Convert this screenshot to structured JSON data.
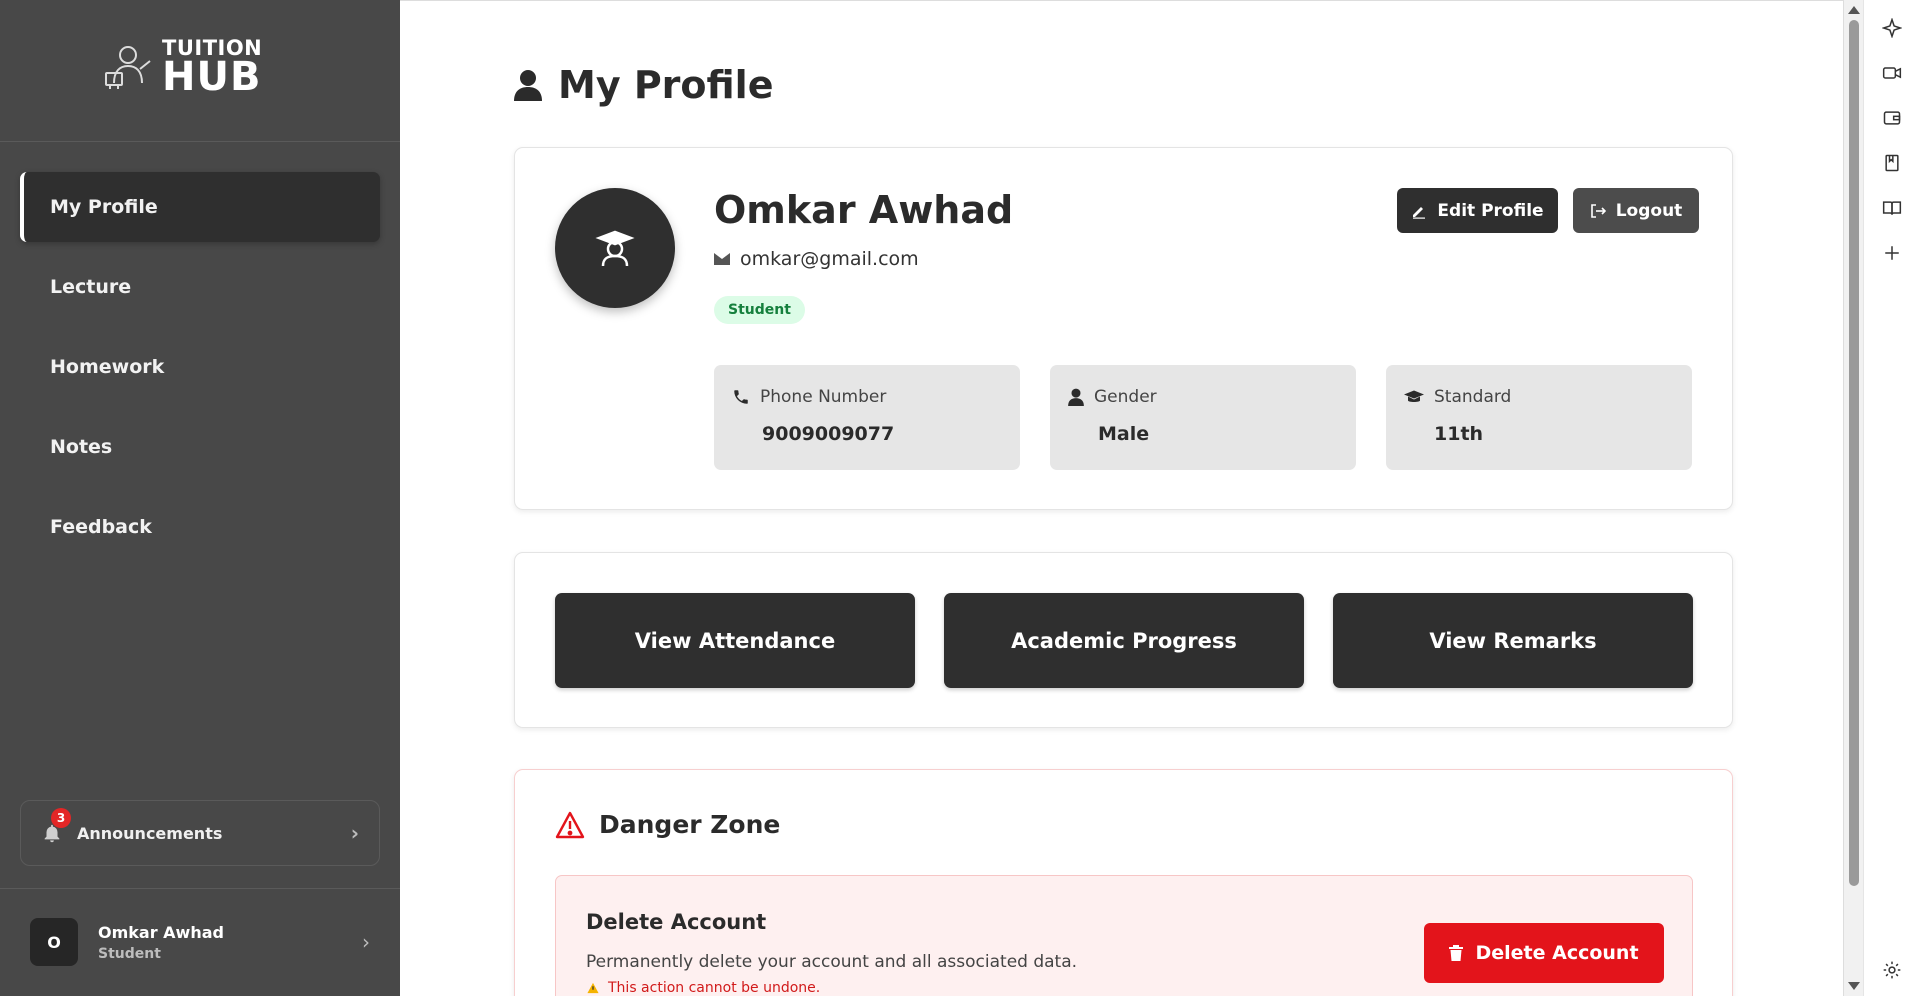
{
  "app": {
    "logo_line1": "TUITION",
    "logo_line2": "HUB"
  },
  "sidebar": {
    "items": [
      {
        "label": "My Profile",
        "active": true
      },
      {
        "label": "Lecture"
      },
      {
        "label": "Homework"
      },
      {
        "label": "Notes"
      },
      {
        "label": "Feedback"
      }
    ],
    "announcements": {
      "label": "Announcements",
      "count": "3"
    },
    "user": {
      "initial": "O",
      "name": "Omkar Awhad",
      "role": "Student"
    }
  },
  "page": {
    "title": "My Profile"
  },
  "profile": {
    "name": "Omkar Awhad",
    "email": "omkar@gmail.com",
    "role": "Student",
    "edit_label": "Edit Profile",
    "logout_label": "Logout",
    "fields": [
      {
        "label": "Phone Number",
        "value": "9009009077",
        "icon": "phone-icon"
      },
      {
        "label": "Gender",
        "value": "Male",
        "icon": "user-icon"
      },
      {
        "label": "Standard",
        "value": "11th",
        "icon": "graduation-cap-icon"
      }
    ]
  },
  "actions": [
    {
      "label": "View Attendance"
    },
    {
      "label": "Academic Progress"
    },
    {
      "label": "View Remarks"
    }
  ],
  "danger": {
    "title": "Danger Zone",
    "heading": "Delete Account",
    "description": "Permanently delete your account and all associated data.",
    "warning": "This action cannot be undone.",
    "button_label": "Delete Account"
  },
  "colors": {
    "sidebar_bg": "#484848",
    "dark": "#2f2f2f",
    "danger_red": "#e3141b",
    "role_pill_bg": "#dcfce7",
    "role_pill_text": "#15803d"
  }
}
